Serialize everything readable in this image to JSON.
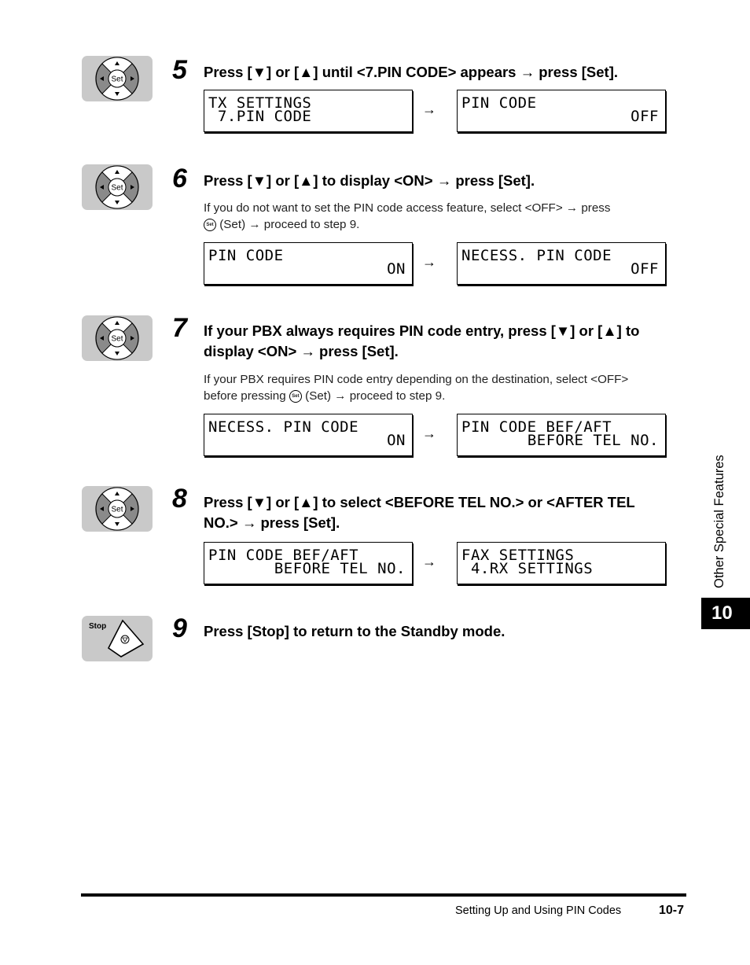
{
  "steps": [
    {
      "number": "5",
      "key": "Set",
      "title": "Press [▼] or [▲] until <7.PIN CODE> appears → press [Set].",
      "description": null,
      "displays": [
        {
          "line1": "TX SETTINGS",
          "line2": " 7.PIN CODE",
          "line2_align": "left"
        },
        {
          "line1": "PIN CODE",
          "line2": "OFF",
          "line2_align": "right"
        }
      ]
    },
    {
      "number": "6",
      "key": "Set",
      "title": "Press [▼] or [▲] to display <ON> → press [Set].",
      "description_part1": "If you do not want to set the PIN code access feature, select <OFF> → press",
      "description_part2": "(Set) → proceed to step 9.",
      "displays": [
        {
          "line1": "PIN CODE",
          "line2": "ON",
          "line2_align": "right"
        },
        {
          "line1": "NECESS. PIN CODE",
          "line2": "OFF",
          "line2_align": "right"
        }
      ]
    },
    {
      "number": "7",
      "key": "Set",
      "title_line1": "If your PBX always requires PIN code entry, press [▼] or [▲] to",
      "title_line2": "display <ON> → press [Set].",
      "description_part1": "If your PBX requires PIN code entry depending on the destination, select <OFF>",
      "description_part2a": "before pressing",
      "description_part2b": "(Set) → proceed to step 9.",
      "displays": [
        {
          "line1": "NECESS. PIN CODE",
          "line2": "ON",
          "line2_align": "right"
        },
        {
          "line1": "PIN CODE BEF/AFT",
          "line2": "BEFORE TEL NO.",
          "line2_align": "right"
        }
      ]
    },
    {
      "number": "8",
      "key": "Set",
      "title_line1": "Press [▼] or [▲] to select <BEFORE TEL NO.> or <AFTER TEL",
      "title_line2": "NO.> → press [Set].",
      "displays": [
        {
          "line1": "PIN CODE BEF/AFT",
          "line2": "BEFORE TEL NO.",
          "line2_align": "right"
        },
        {
          "line1": "FAX SETTINGS",
          "line2": " 4.RX SETTINGS",
          "line2_align": "left"
        }
      ]
    },
    {
      "number": "9",
      "key": "Stop",
      "title": "Press [Stop] to return to the Standby mode."
    }
  ],
  "arrow": "→",
  "set_icon_label": "Set",
  "sidebar": {
    "section": "Other Special Features",
    "chapter": "10"
  },
  "footer": {
    "title": "Setting Up and Using PIN Codes",
    "page": "10-7"
  }
}
